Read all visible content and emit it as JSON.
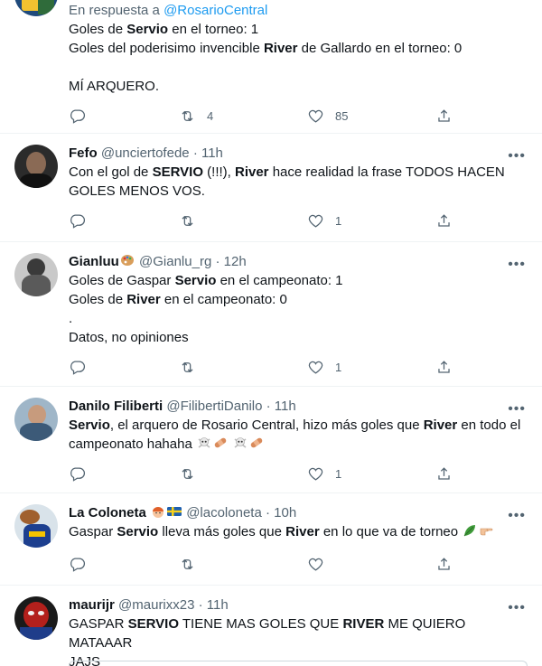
{
  "tweets": [
    {
      "replying_prefix": "En respuesta a",
      "replying_handle": "@RosarioCentral",
      "lines": [
        {
          "segments": [
            {
              "t": "Goles de "
            },
            {
              "t": "Servio",
              "b": true
            },
            {
              "t": " en el torneo: 1"
            }
          ]
        },
        {
          "segments": [
            {
              "t": "Goles del poderisimo invencible "
            },
            {
              "t": "River",
              "b": true
            },
            {
              "t": " de Gallardo en el torneo: 0"
            }
          ]
        },
        {
          "segments": []
        },
        {
          "segments": [
            {
              "t": "MÍ ARQUERO."
            }
          ]
        }
      ],
      "reply_count": "",
      "retweet_count": "4",
      "like_count": "85"
    },
    {
      "name": "Fefo",
      "handle": "@unciertofede",
      "time": "11h",
      "lines": [
        {
          "segments": [
            {
              "t": "Con el gol de "
            },
            {
              "t": "SERVIO",
              "b": true
            },
            {
              "t": " (!!!), "
            },
            {
              "t": "River",
              "b": true
            },
            {
              "t": " hace realidad la frase TODOS HACEN"
            }
          ]
        },
        {
          "segments": [
            {
              "t": "GOLES MENOS VOS."
            }
          ]
        }
      ],
      "reply_count": "",
      "retweet_count": "",
      "like_count": "1"
    },
    {
      "name": "Gianluu",
      "name_emoji": "palette-emoji",
      "handle": "@Gianlu_rg",
      "time": "12h",
      "lines": [
        {
          "segments": [
            {
              "t": "Goles de Gaspar "
            },
            {
              "t": "Servio",
              "b": true
            },
            {
              "t": " en el campeonato: 1"
            }
          ]
        },
        {
          "segments": [
            {
              "t": "Goles de "
            },
            {
              "t": "River",
              "b": true
            },
            {
              "t": " en el campeonato: 0"
            }
          ]
        },
        {
          "segments": [
            {
              "t": "."
            }
          ]
        },
        {
          "segments": [
            {
              "t": "Datos, no opiniones"
            }
          ]
        }
      ],
      "reply_count": "",
      "retweet_count": "",
      "like_count": "1"
    },
    {
      "name": "Danilo Filiberti",
      "handle": "@FilibertiDanilo",
      "time": "11h",
      "lines": [
        {
          "segments": [
            {
              "t": "Servio",
              "b": true
            },
            {
              "t": ", el arquero de Rosario Central, hizo más goles que "
            },
            {
              "t": "River",
              "b": true
            },
            {
              "t": " en todo el"
            }
          ]
        },
        {
          "segments": [
            {
              "t": "campeonato hahaha "
            },
            {
              "emoji": "skull-crossbones-emoji"
            },
            {
              "emoji": "bandage-emoji"
            },
            {
              "t": " "
            },
            {
              "emoji": "skull-crossbones-emoji"
            },
            {
              "emoji": "bandage-emoji"
            }
          ]
        }
      ],
      "reply_count": "",
      "retweet_count": "",
      "like_count": "1"
    },
    {
      "name": "La Coloneta",
      "name_emojis": [
        "person-emoji",
        "sweden-flag-emoji"
      ],
      "handle": "@lacoloneta",
      "time": "10h",
      "lines": [
        {
          "segments": [
            {
              "t": "Gaspar "
            },
            {
              "t": "Servio",
              "b": true
            },
            {
              "t": " lleva más goles que "
            },
            {
              "t": "River",
              "b": true
            },
            {
              "t": " en lo que va de torneo "
            },
            {
              "emoji": "leaf-emoji"
            },
            {
              "emoji": "pointing-hand-emoji"
            }
          ]
        }
      ],
      "reply_count": "",
      "retweet_count": "",
      "like_count": ""
    },
    {
      "name": "maurijr",
      "handle": "@maurixx23",
      "time": "11h",
      "lines": [
        {
          "segments": [
            {
              "t": "GASPAR "
            },
            {
              "t": "SERVIO",
              "b": true
            },
            {
              "t": " TIENE MAS GOLES QUE "
            },
            {
              "t": "RIVER",
              "b": true
            },
            {
              "t": " ME QUIERO MATAAAR"
            }
          ]
        },
        {
          "segments": [
            {
              "t": "JAJS"
            }
          ]
        }
      ]
    }
  ],
  "colors": {
    "link": "#1d9bf0",
    "muted": "#536471",
    "text": "#0f1419",
    "divider": "#eff3f4"
  }
}
